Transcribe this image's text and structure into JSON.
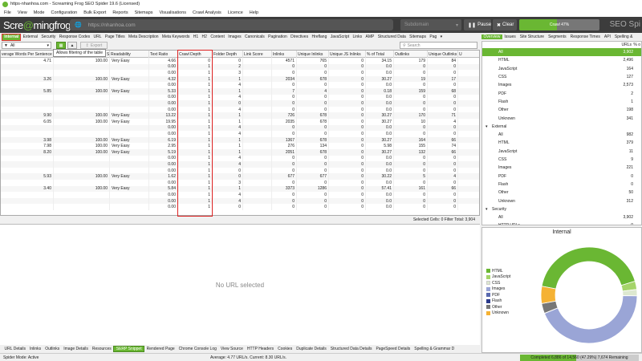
{
  "window_title": "https-nhanhoa.com - Screaming Frog SEO Spider 19.6 (Licensed)",
  "menu": [
    "File",
    "View",
    "Mode",
    "Configuration",
    "Bulk Export",
    "Reports",
    "Sitemaps",
    "Visualisations",
    "Crawl Analysis",
    "Licence",
    "Help"
  ],
  "logo": {
    "part1": "Scre",
    "mid": "@",
    "part2": "mingfrog"
  },
  "url": "https://nhanhoa.com",
  "mode": "Subdomain",
  "buttons": {
    "pause": "Pause",
    "clear": "Clear"
  },
  "crawl_label": "Crawl 47%",
  "crawl_progress": 47,
  "brand": "SEO Spi",
  "main_tabs": [
    "Internal",
    "External",
    "Security",
    "Response Codes",
    "URL",
    "Page Titles",
    "Meta Description",
    "Meta Keywords",
    "H1",
    "H2",
    "Content",
    "Images",
    "Canonicals",
    "Pagination",
    "Directives",
    "Hreflang",
    "JavaScript",
    "Links",
    "AMP",
    "Structured Data",
    "Sitemaps",
    "Pag"
  ],
  "filter": {
    "value": "All",
    "export": "Export",
    "search_placeholder": "Search"
  },
  "tooltip": "Allows filtering of the table",
  "columns": [
    "verage Words Per Sentence",
    "",
    "Flesch Reading Ease Score",
    "Readability",
    "Text Ratio",
    "Crawl Depth",
    "Folder Depth",
    "Link Score",
    "Inlinks",
    "Unique Inlinks",
    "Unique JS Inlinks",
    "% of Total",
    "Outlinks",
    "Unique Outlinks",
    "U"
  ],
  "rows": [
    [
      "4.71",
      "100.00",
      "Very Easy",
      "4.66",
      "0",
      "0",
      "",
      "4571",
      "765",
      "0",
      "34.15",
      "179",
      "84"
    ],
    [
      "",
      "",
      "",
      "0.00",
      "1",
      "2",
      "",
      "0",
      "0",
      "0",
      "0.0",
      "0",
      "0"
    ],
    [
      "",
      "",
      "",
      "0.00",
      "1",
      "3",
      "",
      "0",
      "0",
      "0",
      "0.0",
      "0",
      "0"
    ],
    [
      "3.26",
      "100.00",
      "Very Easy",
      "4.32",
      "1",
      "1",
      "",
      "2034",
      "678",
      "0",
      "30.27",
      "19",
      "17"
    ],
    [
      "",
      "",
      "",
      "0.00",
      "1",
      "4",
      "",
      "0",
      "0",
      "0",
      "0.0",
      "0",
      "0"
    ],
    [
      "5.85",
      "100.00",
      "Very Easy",
      "5.33",
      "1",
      "1",
      "",
      "7",
      "4",
      "0",
      "0.18",
      "159",
      "68"
    ],
    [
      "",
      "",
      "",
      "0.00",
      "1",
      "4",
      "",
      "0",
      "0",
      "0",
      "0.0",
      "0",
      "0"
    ],
    [
      "",
      "",
      "",
      "0.00",
      "1",
      "0",
      "",
      "0",
      "0",
      "0",
      "0.0",
      "0",
      "0"
    ],
    [
      "",
      "",
      "",
      "0.00",
      "1",
      "4",
      "",
      "0",
      "0",
      "0",
      "0.0",
      "0",
      "0"
    ],
    [
      "9.90",
      "100.00",
      "Very Easy",
      "13.22",
      "1",
      "1",
      "",
      "726",
      "678",
      "0",
      "30.27",
      "170",
      "71"
    ],
    [
      "6.05",
      "100.00",
      "Very Easy",
      "19.95",
      "1",
      "1",
      "",
      "2035",
      "678",
      "0",
      "30.27",
      "10",
      "4"
    ],
    [
      "",
      "",
      "",
      "0.00",
      "1",
      "4",
      "",
      "0",
      "0",
      "0",
      "0.0",
      "0",
      "0"
    ],
    [
      "",
      "",
      "",
      "0.00",
      "1",
      "4",
      "",
      "0",
      "0",
      "0",
      "0.0",
      "0",
      "0"
    ],
    [
      "3.98",
      "100.00",
      "Very Easy",
      "6.19",
      "1",
      "1",
      "",
      "1367",
      "678",
      "0",
      "30.27",
      "164",
      "66"
    ],
    [
      "7.98",
      "100.00",
      "Very Easy",
      "2.95",
      "1",
      "1",
      "",
      "276",
      "134",
      "0",
      "5.98",
      "155",
      "74"
    ],
    [
      "8.20",
      "100.00",
      "Very Easy",
      "5.19",
      "1",
      "1",
      "",
      "2051",
      "678",
      "0",
      "30.27",
      "132",
      "66"
    ],
    [
      "",
      "",
      "",
      "0.00",
      "1",
      "4",
      "",
      "0",
      "0",
      "0",
      "0.0",
      "0",
      "0"
    ],
    [
      "",
      "",
      "",
      "0.00",
      "1",
      "4",
      "",
      "0",
      "0",
      "0",
      "0.0",
      "0",
      "0"
    ],
    [
      "",
      "",
      "",
      "0.00",
      "1",
      "0",
      "",
      "0",
      "0",
      "0",
      "0.0",
      "0",
      "0"
    ],
    [
      "5.93",
      "100.00",
      "Very Easy",
      "1.62",
      "1",
      "0",
      "",
      "677",
      "677",
      "0",
      "30.22",
      "5",
      "4"
    ],
    [
      "",
      "",
      "",
      "0.00",
      "1",
      "3",
      "",
      "0",
      "0",
      "0",
      "0.0",
      "0",
      "0"
    ],
    [
      "3.40",
      "100.00",
      "Very Easy",
      "5.84",
      "1",
      "1",
      "",
      "3373",
      "1286",
      "0",
      "57.41",
      "161",
      "66"
    ],
    [
      "",
      "",
      "",
      "0.00",
      "1",
      "4",
      "",
      "0",
      "0",
      "0",
      "0.0",
      "0",
      "0"
    ],
    [
      "",
      "",
      "",
      "0.00",
      "1",
      "4",
      "",
      "0",
      "0",
      "0",
      "0.0",
      "0",
      "0"
    ],
    [
      "",
      "",
      "",
      "0.00",
      "1",
      "0",
      "",
      "0",
      "0",
      "0",
      "0.0",
      "0",
      "0"
    ]
  ],
  "selected_cells_text": "Selected Cells:  0  Filter Total:  3,904",
  "no_url_text": "No URL selected",
  "bottom_tabs": [
    "URL Details",
    "Inlinks",
    "Outlinks",
    "Image Details",
    "Resources",
    "SERP Snippet",
    "Rendered Page",
    "Chrome Console Log",
    "View Source",
    "HTTP Headers",
    "Cookies",
    "Duplicate Details",
    "Structured Data Details",
    "PageSpeed Details",
    "Spelling & Grammar D"
  ],
  "status_left": "Spider Mode: Active",
  "status_center": "Average: 4.77 URL/s. Current: 8.30 URL/s.",
  "status_right": "Completed 6,886 of 14,560 (47.29%) 7,674 Remaining",
  "status_progress": 47.29,
  "right_tabs": [
    "Overview",
    "Issues",
    "Site Structure",
    "Segments",
    "Response Times",
    "API",
    "Spelling &"
  ],
  "right_header": {
    "urls": "URLs",
    "pct": "% o"
  },
  "overview": [
    {
      "label": "All",
      "value": "3,902",
      "level": 1,
      "sel": true
    },
    {
      "label": "HTML",
      "value": "2,496",
      "level": 1
    },
    {
      "label": "JavaScript",
      "value": "164",
      "level": 1
    },
    {
      "label": "CSS",
      "value": "127",
      "level": 1
    },
    {
      "label": "Images",
      "value": "2,573",
      "level": 1
    },
    {
      "label": "PDF",
      "value": "2",
      "level": 1
    },
    {
      "label": "Flash",
      "value": "1",
      "level": 1
    },
    {
      "label": "Other",
      "value": "198",
      "level": 1
    },
    {
      "label": "Unknown",
      "value": "341",
      "level": 1
    },
    {
      "label": "External",
      "value": "",
      "level": 0
    },
    {
      "label": "All",
      "value": "982",
      "level": 1
    },
    {
      "label": "HTML",
      "value": "379",
      "level": 1
    },
    {
      "label": "JavaScript",
      "value": "11",
      "level": 1
    },
    {
      "label": "CSS",
      "value": "9",
      "level": 1
    },
    {
      "label": "Images",
      "value": "221",
      "level": 1
    },
    {
      "label": "PDF",
      "value": "0",
      "level": 1
    },
    {
      "label": "Flash",
      "value": "0",
      "level": 1
    },
    {
      "label": "Other",
      "value": "50",
      "level": 1
    },
    {
      "label": "Unknown",
      "value": "312",
      "level": 1
    },
    {
      "label": "Security",
      "value": "",
      "level": 0
    },
    {
      "label": "All",
      "value": "3,902",
      "level": 1
    },
    {
      "label": "HTTP URLs",
      "value": "0",
      "level": 1
    }
  ],
  "chart_data": {
    "type": "pie",
    "title": "Internal",
    "categories": [
      "HTML",
      "JavaScript",
      "CSS",
      "Images",
      "PDF",
      "Flash",
      "Other",
      "Unknown"
    ],
    "values": [
      2496,
      164,
      127,
      2573,
      2,
      1,
      198,
      341
    ],
    "colors": [
      "#6ab733",
      "#a5d46a",
      "#dde8d0",
      "#9aa5d6",
      "#5a6ab0",
      "#2a3a8a",
      "#777777",
      "#f5b234"
    ]
  }
}
